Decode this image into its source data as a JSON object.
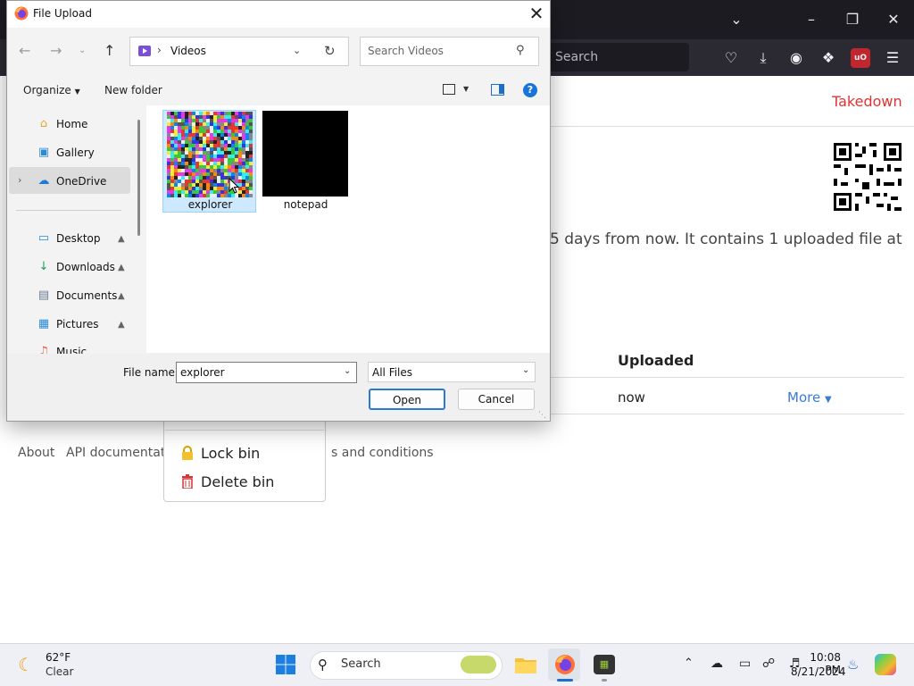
{
  "browser": {
    "search_placeholder": "Search",
    "takedown_label": "Takedown",
    "info_text": "5 days from now. It contains 1 uploaded file at",
    "table_header_uploaded": "Uploaded",
    "row_uploaded": "now",
    "row_more": "More",
    "footer_about": "About",
    "footer_api": "API documentatio",
    "footer_terms": "s and conditions",
    "menu_lock": "Lock bin",
    "menu_delete": "Delete bin"
  },
  "dialog": {
    "title": "File Upload",
    "address_path": "Videos",
    "search_placeholder": "Search Videos",
    "organize_label": "Organize",
    "new_folder_label": "New folder",
    "nav_items": [
      "Home",
      "Gallery",
      "OneDrive",
      "Desktop",
      "Downloads",
      "Documents",
      "Pictures",
      "Music"
    ],
    "files": [
      "explorer",
      "notepad"
    ],
    "file_name_label": "File name:",
    "file_name_value": "explorer",
    "file_type_value": "All Files",
    "open_label": "Open",
    "cancel_label": "Cancel"
  },
  "taskbar": {
    "weather_temp": "62°F",
    "weather_desc": "Clear",
    "search_label": "Search",
    "time": "10:08 PM",
    "date": "8/21/2024"
  },
  "colors": {
    "accent_link": "#3b7bd4",
    "takedown_red": "#dd3333",
    "selection": "#cde8ff",
    "browser_dark": "#2b2a33"
  }
}
